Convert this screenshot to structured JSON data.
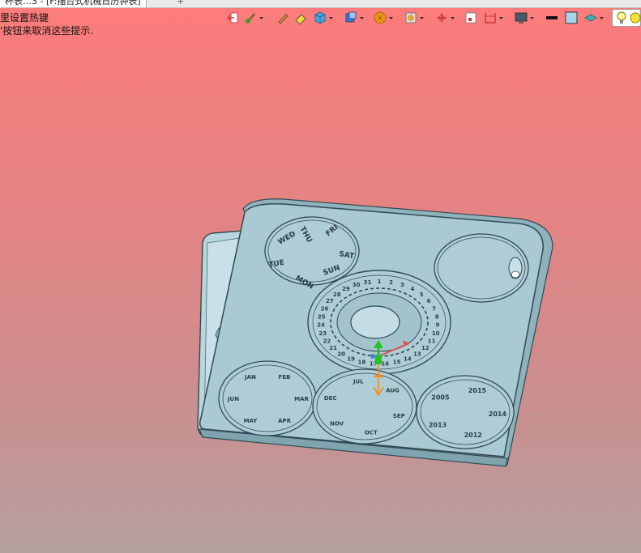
{
  "document": {
    "tab_title": "杯表…3 - [F:描台式机械日历钟表]",
    "add_tab_symbol": "+"
  },
  "hint": {
    "line1": "里设置热键",
    "line2": "'按钮来取消这些提示."
  },
  "toolbar": {
    "items": [
      {
        "icon": "exit-sketch-icon"
      },
      {
        "icon": "paint-brush-icon"
      },
      {
        "icon": "pencil-icon"
      },
      {
        "icon": "eraser-icon"
      },
      {
        "icon": "cube-icon"
      },
      {
        "icon": "view-cube-icon"
      },
      {
        "icon": "render-ball-icon"
      },
      {
        "icon": "section-view-icon"
      },
      {
        "icon": "triad-icon"
      },
      {
        "icon": "frame-icon"
      },
      {
        "icon": "measure-icon"
      },
      {
        "icon": "monitor-icon"
      },
      {
        "icon": "line-color-icon"
      },
      {
        "icon": "fill-color-icon"
      },
      {
        "icon": "plane-icon"
      },
      {
        "icon": "light-bulb-icon"
      }
    ]
  },
  "model": {
    "weekday_labels": [
      "WED",
      "TUE",
      "MON",
      "SUN",
      "SAT",
      "FRI",
      "THU"
    ],
    "date_labels": [
      "1",
      "2",
      "3",
      "4",
      "5",
      "6",
      "7",
      "8",
      "9",
      "10",
      "11",
      "12",
      "13",
      "14",
      "15",
      "16",
      "17",
      "18",
      "19",
      "20",
      "21",
      "22",
      "23",
      "24",
      "25",
      "26",
      "27",
      "28",
      "29",
      "30",
      "31"
    ],
    "month_labels": [
      "JAN",
      "FEB",
      "MAR",
      "APR",
      "MAY",
      "JUN",
      "JUL",
      "AUG",
      "SEP",
      "OCT",
      "NOV",
      "DEC"
    ],
    "year_labels": [
      "2005",
      "2015",
      "2014",
      "2012",
      "2013"
    ],
    "colors": {
      "body": "#a9c9d3",
      "edge": "#2f4a52",
      "shade": "#8fb2bd",
      "axis_x": "#d9534f",
      "axis_y": "#22c322",
      "axis_z": "#f08a1c"
    }
  }
}
